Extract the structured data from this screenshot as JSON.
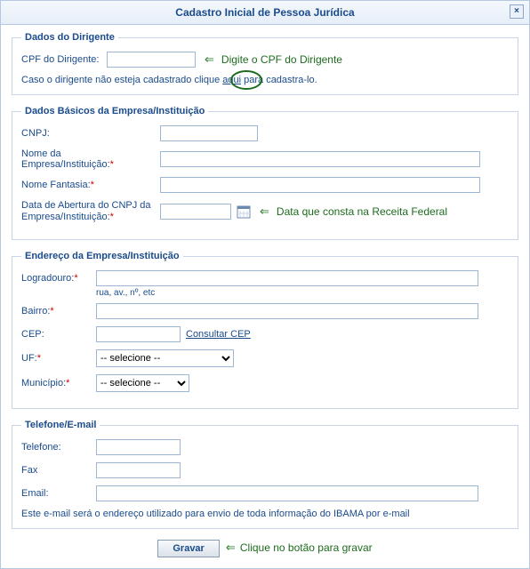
{
  "window": {
    "title": "Cadastro Inicial de Pessoa Jurídica",
    "close": "×"
  },
  "dirigente": {
    "legend": "Dados do Dirigente",
    "cpf_label": "CPF do Dirigente:",
    "cpf_value": "",
    "hint": "Digite o CPF do Dirigente",
    "note_prefix": "Caso o dirigente não esteja cadastrado clique ",
    "note_link": "aqui",
    "note_suffix": " para cadastra-lo."
  },
  "empresa": {
    "legend": "Dados Básicos da Empresa/Instituição",
    "cnpj_label": "CNPJ:",
    "cnpj_value": "",
    "nome_label": "Nome da Empresa/Instituição:",
    "nome_value": "",
    "fantasia_label": "Nome Fantasia:",
    "fantasia_value": "",
    "data_label": "Data de Abertura do CNPJ da Empresa/Instituição:",
    "data_value": "",
    "data_hint": "Data que consta na Receita Federal",
    "req": "*"
  },
  "endereco": {
    "legend": "Endereço da Empresa/Instituição",
    "logradouro_label": "Logradouro:",
    "logradouro_value": "",
    "logradouro_hint": "rua, av., nº, etc",
    "bairro_label": "Bairro:",
    "bairro_value": "",
    "cep_label": "CEP:",
    "cep_value": "",
    "cep_link": "Consultar CEP",
    "uf_label": "UF:",
    "uf_selected": "-- selecione --",
    "municipio_label": "Município:",
    "municipio_selected": "-- selecione --",
    "req": "*"
  },
  "contato": {
    "legend": "Telefone/E-mail",
    "telefone_label": "Telefone:",
    "telefone_value": "",
    "fax_label": "Fax",
    "fax_value": "",
    "email_label": "Email:",
    "email_value": "",
    "note": "Este e-mail será o endereço utilizado para envio de toda informação do IBAMA por e-mail"
  },
  "footer": {
    "save_label": "Gravar",
    "save_hint": "Clique no botão para gravar"
  }
}
